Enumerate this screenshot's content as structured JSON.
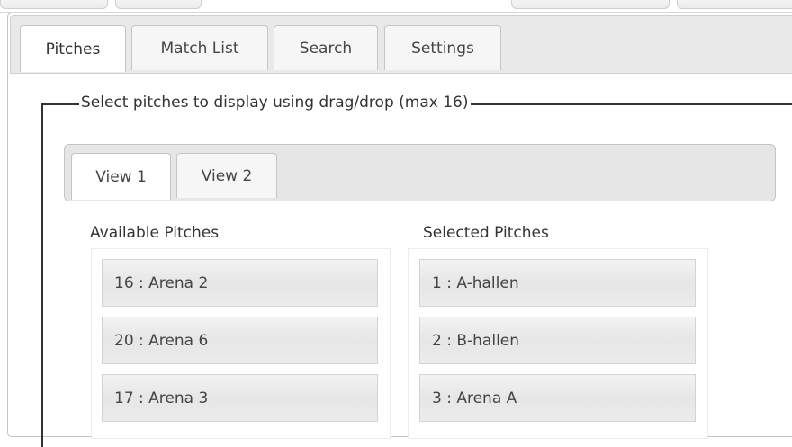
{
  "main_tabs": [
    "Pitches",
    "Match List",
    "Search",
    "Settings"
  ],
  "fieldset_legend": "Select pitches to display using drag/drop (max 16)",
  "view_tabs": [
    "View 1",
    "View 2"
  ],
  "available": {
    "heading": "Available Pitches",
    "items": [
      "16 : Arena 2",
      "20 : Arena 6",
      "17 : Arena 3"
    ]
  },
  "selected": {
    "heading": "Selected Pitches",
    "items": [
      "1 : A-hallen",
      "2 : B-hallen",
      "3 : Arena A"
    ]
  }
}
